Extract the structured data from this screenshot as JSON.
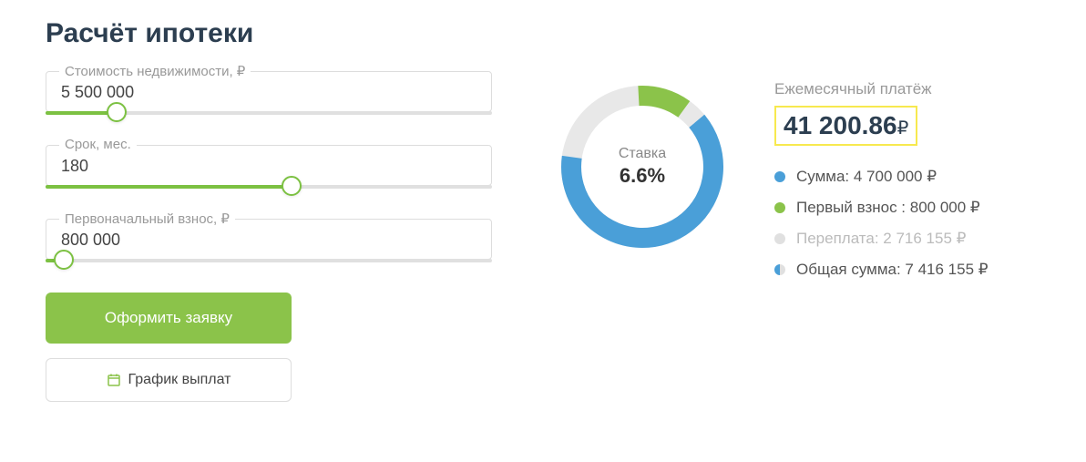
{
  "title": "Расчёт ипотеки",
  "fields": {
    "property": {
      "label": "Стоимость недвижимости, ₽",
      "value": "5 500 000",
      "percent": 16
    },
    "term": {
      "label": "Срок, мес.",
      "value": "180",
      "percent": 55
    },
    "downpayment": {
      "label": "Первоначальный взнос, ₽",
      "value": "800 000",
      "percent": 4
    }
  },
  "buttons": {
    "apply": "Оформить заявку",
    "schedule": "График выплат"
  },
  "donut": {
    "label": "Ставка",
    "value": "6.6%"
  },
  "summary": {
    "monthly_label": "Ежемесячный платёж",
    "monthly_value": "41 200.86",
    "monthly_currency": "₽",
    "items": [
      {
        "color": "#4a9fd8",
        "label": "Сумма",
        "value": "4 700 000 ₽",
        "muted": false
      },
      {
        "color": "#8bc34a",
        "label": "Первый взнос ",
        "value": "800 000 ₽",
        "muted": false
      },
      {
        "color": "#e0e0e0",
        "label": "Переплата",
        "value": "2 716 155 ₽",
        "muted": true
      },
      {
        "color": "half",
        "label": "Общая сумма",
        "value": "7 416 155 ₽",
        "muted": false
      }
    ]
  },
  "chart_data": {
    "type": "pie",
    "title": "Ставка 6.6%",
    "series": [
      {
        "name": "Сумма",
        "value": 4700000,
        "color": "#4a9fd8"
      },
      {
        "name": "Первый взнос",
        "value": 800000,
        "color": "#8bc34a"
      },
      {
        "name": "Переплата",
        "value": 2716155,
        "color": "#e8e8e8"
      }
    ],
    "total": 7416155
  }
}
